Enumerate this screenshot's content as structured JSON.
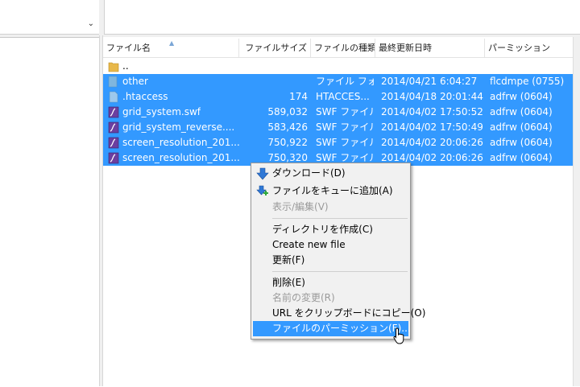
{
  "columns": [
    "ファイル名",
    "ファイルサイズ",
    "ファイルの種類",
    "最終更新日時",
    "パーミッション"
  ],
  "rows": [
    {
      "name": "..",
      "size": "",
      "type": "",
      "modified": "",
      "perm": "",
      "icon": "folder-icon",
      "selected": false
    },
    {
      "name": "other",
      "size": "",
      "type": "ファイル フォ...",
      "modified": "2014/04/21 6:04:27",
      "perm": "flcdmpe (0755)",
      "icon": "folder-icon",
      "selected": true
    },
    {
      "name": ".htaccess",
      "size": "174",
      "type": "HTACCES...",
      "modified": "2014/04/18 20:01:44",
      "perm": "adfrw (0604)",
      "icon": "file-icon",
      "selected": true
    },
    {
      "name": "grid_system.swf",
      "size": "589,032",
      "type": "SWF ファイル",
      "modified": "2014/04/02 17:50:52",
      "perm": "adfrw (0604)",
      "icon": "swf-icon",
      "selected": true
    },
    {
      "name": "grid_system_reverse....",
      "size": "583,426",
      "type": "SWF ファイル",
      "modified": "2014/04/02 17:50:49",
      "perm": "adfrw (0604)",
      "icon": "swf-icon",
      "selected": true
    },
    {
      "name": "screen_resolution_201...",
      "size": "750,922",
      "type": "SWF ファイル",
      "modified": "2014/04/02 20:06:26",
      "perm": "adfrw (0604)",
      "icon": "swf-icon",
      "selected": true
    },
    {
      "name": "screen_resolution_201...",
      "size": "750,320",
      "type": "SWF ファイル",
      "modified": "2014/04/02 20:06:26",
      "perm": "adfrw (0604)",
      "icon": "swf-icon",
      "selected": true
    }
  ],
  "menu": {
    "download": "ダウンロード(D)",
    "add_to_queue": "ファイルをキューに追加(A)",
    "view_edit": "表示/編集(V)",
    "create_dir": "ディレクトリを作成(C)",
    "create_file": "Create new file",
    "refresh": "更新(F)",
    "delete": "削除(E)",
    "rename": "名前の変更(R)",
    "copy_url": "URL をクリップボードにコピー(O)",
    "permissions": "ファイルのパーミッション(F)..."
  },
  "colors": {
    "selection": "#3399ff",
    "menu_bg": "#f1f1f1",
    "folder": "#e8b84a",
    "swf": "#6b3fa0"
  }
}
